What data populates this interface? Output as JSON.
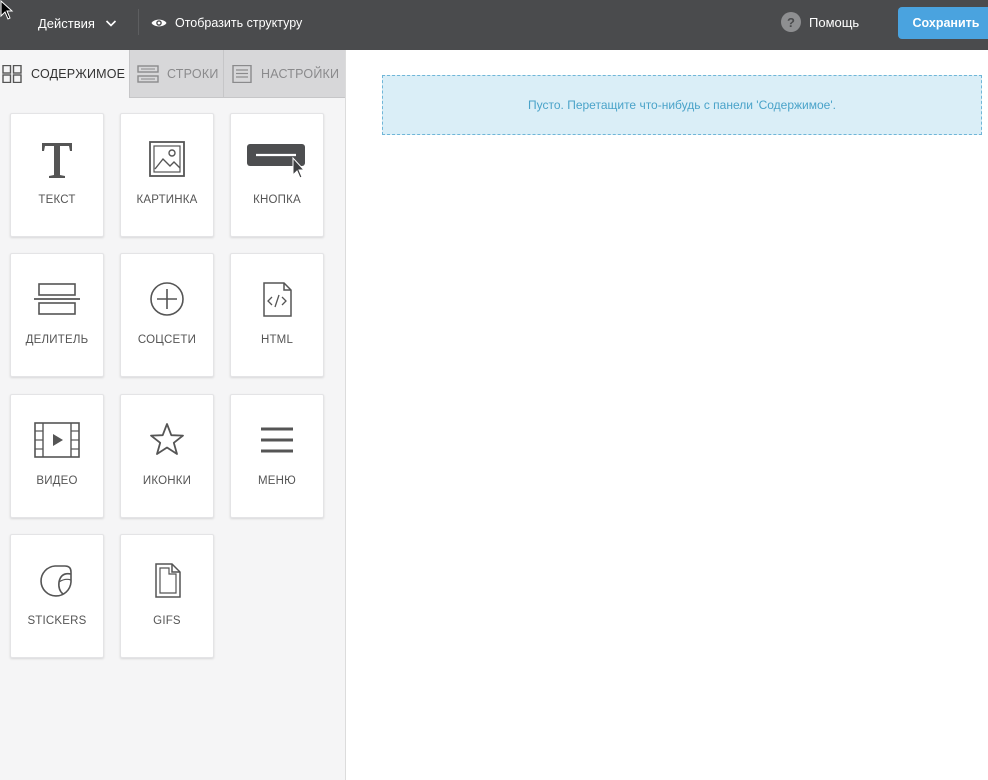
{
  "topbar": {
    "actions_label": "Действия",
    "structure_label": "Отобразить структуру",
    "help_label": "Помощь",
    "help_glyph": "?",
    "save_label": "Сохранить"
  },
  "tabs": [
    {
      "label": "СОДЕРЖИМОЕ",
      "icon": "grid-icon"
    },
    {
      "label": "СТРОКИ",
      "icon": "rows-icon"
    },
    {
      "label": "НАСТРОЙКИ",
      "icon": "settings-panel-icon"
    }
  ],
  "blocks": [
    {
      "label": "ТЕКСТ",
      "icon": "text-icon"
    },
    {
      "label": "КАРТИНКА",
      "icon": "image-icon"
    },
    {
      "label": "КНОПКА",
      "icon": "button-icon"
    },
    {
      "label": "ДЕЛИТЕЛЬ",
      "icon": "divider-icon"
    },
    {
      "label": "СОЦСЕТИ",
      "icon": "social-icon"
    },
    {
      "label": "HTML",
      "icon": "html-icon"
    },
    {
      "label": "ВИДЕО",
      "icon": "video-icon"
    },
    {
      "label": "ИКОНКИ",
      "icon": "star-icon"
    },
    {
      "label": "МЕНЮ",
      "icon": "menu-icon"
    },
    {
      "label": "STICKERS",
      "icon": "sticker-icon"
    },
    {
      "label": "GIFS",
      "icon": "gif-file-icon"
    }
  ],
  "canvas": {
    "empty_message": "Пусто. Перетащите что-нибудь с панели 'Содержимое'."
  },
  "colors": {
    "topbar": "#4a4b4d",
    "accent": "#4aa3df",
    "drop_zone_bg": "#daeef7",
    "drop_zone_text": "#4aa3c9"
  }
}
